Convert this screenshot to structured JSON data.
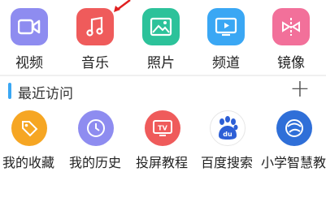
{
  "apps": [
    {
      "label": "视频",
      "icon": "video-camera-icon",
      "color": "#8e8cf0"
    },
    {
      "label": "音乐",
      "icon": "music-note-icon",
      "color": "#ef5b5b"
    },
    {
      "label": "照片",
      "icon": "photo-icon",
      "color": "#2cc29a"
    },
    {
      "label": "频道",
      "icon": "tv-channel-icon",
      "color": "#3aa7f4"
    },
    {
      "label": "镜像",
      "icon": "mirror-icon",
      "color": "#f2709a"
    }
  ],
  "recent": {
    "title": "最近访问",
    "add_label": "+",
    "items": [
      {
        "label": "我的收藏",
        "icon": "tag-icon",
        "color": "#f6a623"
      },
      {
        "label": "我的历史",
        "icon": "clock-icon",
        "color": "#8e8cf0"
      },
      {
        "label": "投屏教程",
        "icon": "tv-tutorial-icon",
        "color": "#ef5b5b"
      },
      {
        "label": "百度搜索",
        "icon": "baidu-paw-icon",
        "color": "#ffffff"
      },
      {
        "label": "小学智慧教",
        "icon": "globe-icon",
        "color": "#2f6fd8"
      }
    ]
  },
  "annotation": {
    "color": "#e02020"
  }
}
